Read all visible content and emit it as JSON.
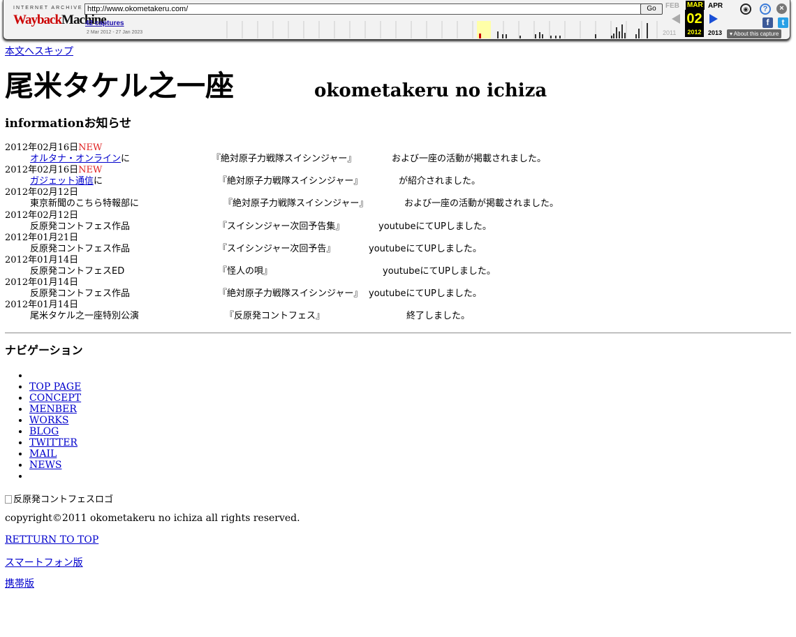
{
  "wayback": {
    "ia_text": "INTERNET ARCHIVE",
    "logo_red": "Wayback",
    "logo_dark": "Machine",
    "url": "http://www.okometakeru.com/",
    "go_label": "Go",
    "captures": "42 captures",
    "date_range": "2 Mar 2012 - 27 Jan 2023",
    "prev_month": "FEB",
    "cur_month": "MAR",
    "next_month": "APR",
    "day": "02",
    "prev_year": "2011",
    "cur_year": "2012",
    "next_year": "2013",
    "about": "About this capture",
    "fb": "f",
    "tw": "t",
    "help": "?",
    "close": "×",
    "user": "◉"
  },
  "skip_link": "本文へスキップ",
  "title_jp": "尾米タケル之一座",
  "title_en": "okometakeru no ichiza",
  "info": {
    "heading": "informationお知らせ",
    "items": [
      {
        "date": "2012年02月16日",
        "new": "NEW",
        "link": "オルタナ・オンライン",
        "text1": "に",
        "work": "『絶対原子力戦隊スイシンジャー』",
        "text2": "および一座の活動が掲載されました。"
      },
      {
        "date": "2012年02月16日",
        "new": "NEW",
        "link": "ガジェット通信",
        "text1": "に",
        "work": "『絶対原子力戦隊スイシンジャー』",
        "text2": "が紹介されました。"
      },
      {
        "date": "2012年02月12日",
        "new": "",
        "link": "",
        "text1": "東京新聞のこちら特報部に",
        "work": "『絶対原子力戦隊スイシンジャー』",
        "text2": "および一座の活動が掲載されました。"
      },
      {
        "date": "2012年02月12日",
        "new": "",
        "link": "",
        "text1": "反原発コントフェス作品",
        "work": "『スイシンジャー次回予告集』",
        "text2": "youtubeにてUPしました。"
      },
      {
        "date": "2012年01月21日",
        "new": "",
        "link": "",
        "text1": "反原発コントフェス作品",
        "work": "『スイシンジャー次回予告』",
        "text2": "youtubeにてUPしました。"
      },
      {
        "date": "2012年01月14日",
        "new": "",
        "link": "",
        "text1": "反原発コントフェスED",
        "work": "『怪人の唄』",
        "text2": "youtubeにてUPしました。"
      },
      {
        "date": "2012年01月14日",
        "new": "",
        "link": "",
        "text1": "反原発コントフェス作品",
        "work": "『絶対原子力戦隊スイシンジャー』",
        "text2": "youtubeにてUPしました。"
      },
      {
        "date": "2012年01月14日",
        "new": "",
        "link": "",
        "text1": "尾米タケル之一座特別公演",
        "work": "『反原発コントフェス』",
        "text2": "終了しました。"
      }
    ]
  },
  "nav": {
    "heading": "ナビゲーション",
    "items": [
      "",
      "TOP PAGE",
      "CONCEPT",
      "MENBER",
      "WORKS",
      "BLOG",
      "TWITTER",
      "MAIL",
      "NEWS",
      ""
    ]
  },
  "logo_alt": "反原発コントフェスロゴ",
  "copyright": "copyright©2011 okometakeru no ichiza all rights reserved.",
  "return_top": "RETTURN TO TOP",
  "smartphone": "スマートフォン版",
  "mobile": "携帯版"
}
